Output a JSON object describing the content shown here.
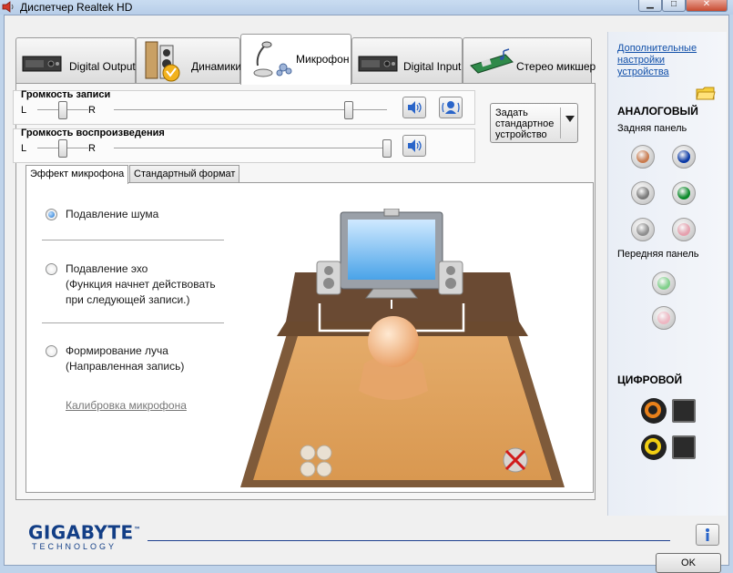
{
  "window": {
    "title": "Диспетчер Realtek HD"
  },
  "tabs": [
    {
      "label": "Digital Output"
    },
    {
      "label": "Динамики"
    },
    {
      "label": "Микрофон"
    },
    {
      "label": "Digital Input"
    },
    {
      "label": "Стерео микшер"
    }
  ],
  "record_volume": {
    "title": "Громкость записи",
    "left": "L",
    "right": "R",
    "balance_value": 0.5,
    "level_value": 0.86
  },
  "playback_volume": {
    "title": "Громкость воспроизведения",
    "left": "L",
    "right": "R",
    "balance_value": 0.5,
    "level_value": 1.0
  },
  "default_device_button": {
    "line1": "Задать",
    "line2": "стандартное",
    "line3": "устройство"
  },
  "subtabs": [
    {
      "label": "Эффект микрофона"
    },
    {
      "label": "Стандартный формат"
    }
  ],
  "options": {
    "noise": {
      "label": "Подавление шума",
      "checked": true
    },
    "echo": {
      "line1": "Подавление эхо",
      "line2": "(Функция начнет действовать",
      "line3": "при следующей записи.)",
      "checked": false
    },
    "beam": {
      "line1": "Формирование луча",
      "line2": "(Направленная запись)",
      "checked": false
    }
  },
  "calibration_link": "Калибровка микрофона",
  "sidebar": {
    "advanced_link_line1": "Дополнительные",
    "advanced_link_line2": "настройки",
    "advanced_link_line3": "устройства",
    "analog_title": "АНАЛОГОВЫЙ",
    "rear_panel": "Задняя панель",
    "front_panel": "Передняя панель",
    "digital_title": "ЦИФРОВОЙ",
    "rear_jacks": [
      {
        "color": "#c97b4e"
      },
      {
        "color": "#0b3aa6"
      },
      {
        "color": "#7a7a7a"
      },
      {
        "color": "#0a8a2a"
      },
      {
        "color": "#8f8f8f"
      },
      {
        "color": "#e6a0ae"
      }
    ],
    "front_jacks": [
      {
        "color": "#7fd08a"
      },
      {
        "color": "#eeb6c2"
      }
    ],
    "digital_jacks": [
      {
        "color": "#e8801a"
      },
      {
        "color": "#f2cf13"
      }
    ]
  },
  "footer": {
    "brand": "GIGABYTE",
    "brand_tm": "™",
    "brand_sub": "TECHNOLOGY",
    "ok_label": "OK"
  }
}
